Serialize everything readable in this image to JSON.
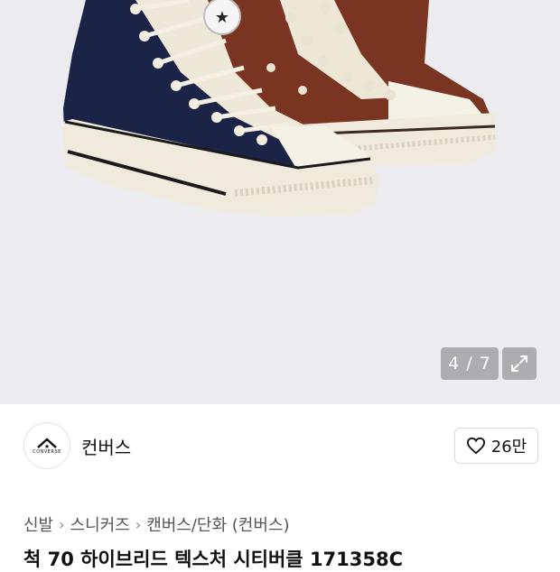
{
  "gallery": {
    "counter": "4 / 7",
    "expand_icon": "expand-arrows-icon",
    "colors": {
      "navy": "#1b2447",
      "brown": "#7a3422",
      "cream": "#f2efe4",
      "background": "#ecebef"
    }
  },
  "brand": {
    "name": "컨버스",
    "logo_text": "CONVERSE",
    "logo_icon": "converse-chevron-star-icon"
  },
  "like": {
    "icon": "heart-outline-icon",
    "count": "26만"
  },
  "breadcrumb": {
    "items": [
      "신발",
      "스니커즈",
      "캔버스/단화 (컨버스)"
    ],
    "separator_icon": "chevron-right-icon"
  },
  "product": {
    "title": "척 70 하이브리드 텍스처 시티버클 171358C"
  }
}
